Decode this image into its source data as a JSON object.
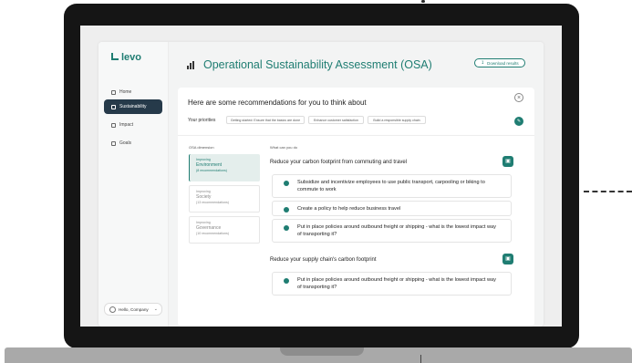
{
  "app": {
    "logo": "levo",
    "page_title": "Operational Sustainability Assessment (OSA)",
    "download_label": "Download results"
  },
  "sidebar": {
    "items": [
      {
        "label": "Home",
        "icon": "home-icon"
      },
      {
        "label": "Sustainability",
        "icon": "chart-icon"
      },
      {
        "label": "Impact",
        "icon": "impact-icon"
      },
      {
        "label": "Goals",
        "icon": "goals-icon"
      }
    ],
    "account_label": "Hello, Company"
  },
  "recommendations": {
    "title": "Here are some recommendations for you to think about",
    "priorities_label": "Your priorities",
    "priorities": [
      "Getting started: Ensure that the basics are done",
      "Enhance customer satisfaction",
      "Build a responsible supply chain"
    ],
    "dimensions_header": "OSA dimension",
    "actions_header": "What can you do",
    "dimensions": [
      {
        "status": "Improving",
        "name": "Environment",
        "count": "(8 recommendations)"
      },
      {
        "status": "Improving",
        "name": "Society",
        "count": "(13 recommendations)"
      },
      {
        "status": "Improving",
        "name": "Governance",
        "count": "(10 recommendations)"
      }
    ],
    "sections": [
      {
        "title": "Reduce your carbon footprint from commuting and travel",
        "items": [
          "Subsidize and incentivize employees to use public transport, carpooling or biking to commute to work",
          "Create a policy to help reduce business travel",
          "Put in place policies around outbound freight or shipping - what is the lowest impact way of transporting it?"
        ]
      },
      {
        "title": "Reduce your supply chain's carbon footprint",
        "items": [
          "Put in place policies around outbound freight or shipping - what is the lowest impact way of transporting it?"
        ]
      }
    ]
  },
  "colors": {
    "accent": "#1f7d72",
    "sidebar_active": "#263a4a"
  }
}
